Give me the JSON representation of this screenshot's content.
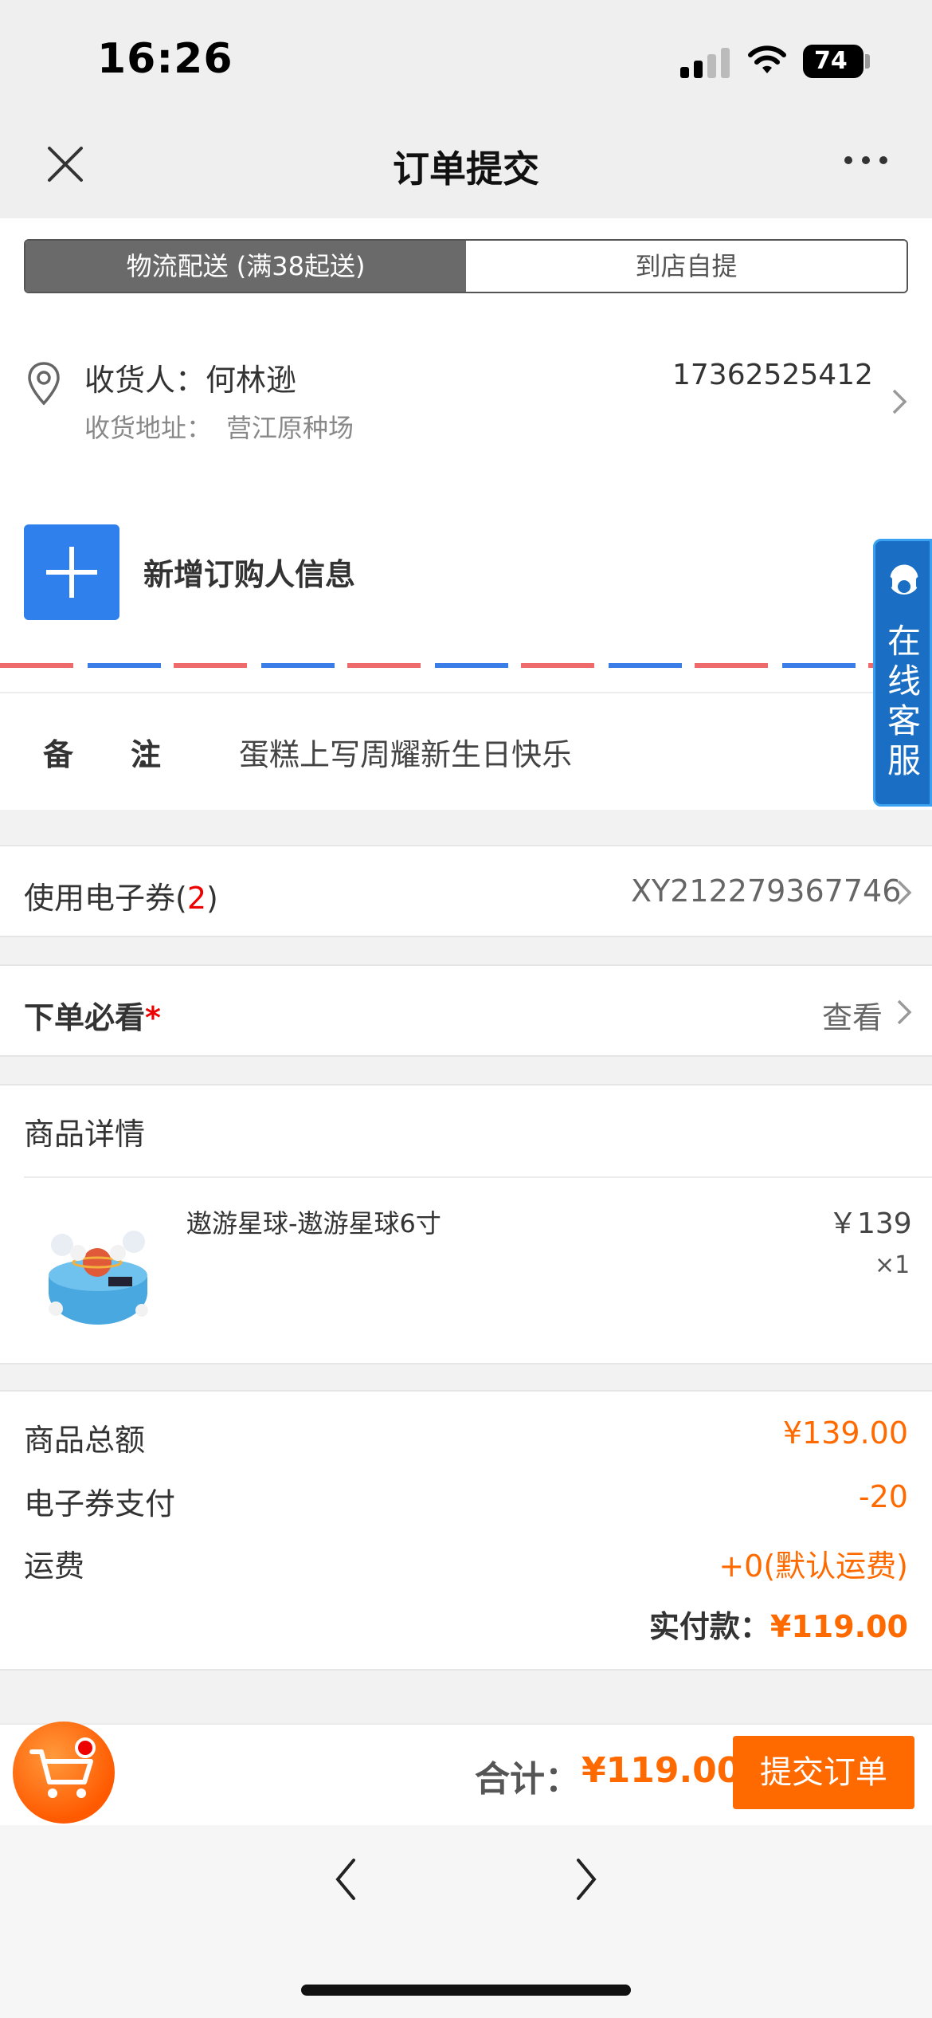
{
  "status": {
    "time": "16:26",
    "battery": "74"
  },
  "nav": {
    "title": "订单提交"
  },
  "delivery_tabs": [
    "物流配送 (满38起送)",
    "到店自提"
  ],
  "address": {
    "receiver": "收货人：何林逊",
    "phone": "17362525412",
    "address_label": "收货地址：",
    "address": "营江原种场"
  },
  "add_buyer": {
    "label": "新增订购人信息"
  },
  "remark": {
    "label": "备注",
    "colon": "：",
    "value": "蛋糕上写周耀新生日快乐"
  },
  "service": {
    "text": "在线客服"
  },
  "coupon": {
    "label": "使用电子券(",
    "count": "2",
    "suffix": ")",
    "code": "XY212279367746"
  },
  "must_read": {
    "label": "下单必看",
    "star": "*",
    "view": "查看"
  },
  "goods": {
    "title": "商品详情",
    "items": [
      {
        "name": "遨游星球-遨游星球6寸",
        "price": "￥139",
        "qty": "×1"
      }
    ]
  },
  "summary": {
    "rows": [
      {
        "label": "商品总额",
        "value": "¥139.00"
      },
      {
        "label": "电子券支付",
        "value": "-20"
      },
      {
        "label": "运费",
        "value": "+0(默认运费)"
      }
    ],
    "paid_label": "实付款：",
    "paid_value": "¥119.00"
  },
  "bottom": {
    "total_label": "合计：",
    "total_value": "¥119.00",
    "submit": "提交订单"
  },
  "colors": {
    "accent": "#ff6a00",
    "blue": "#2f80ed",
    "service": "#1a6fc4"
  }
}
